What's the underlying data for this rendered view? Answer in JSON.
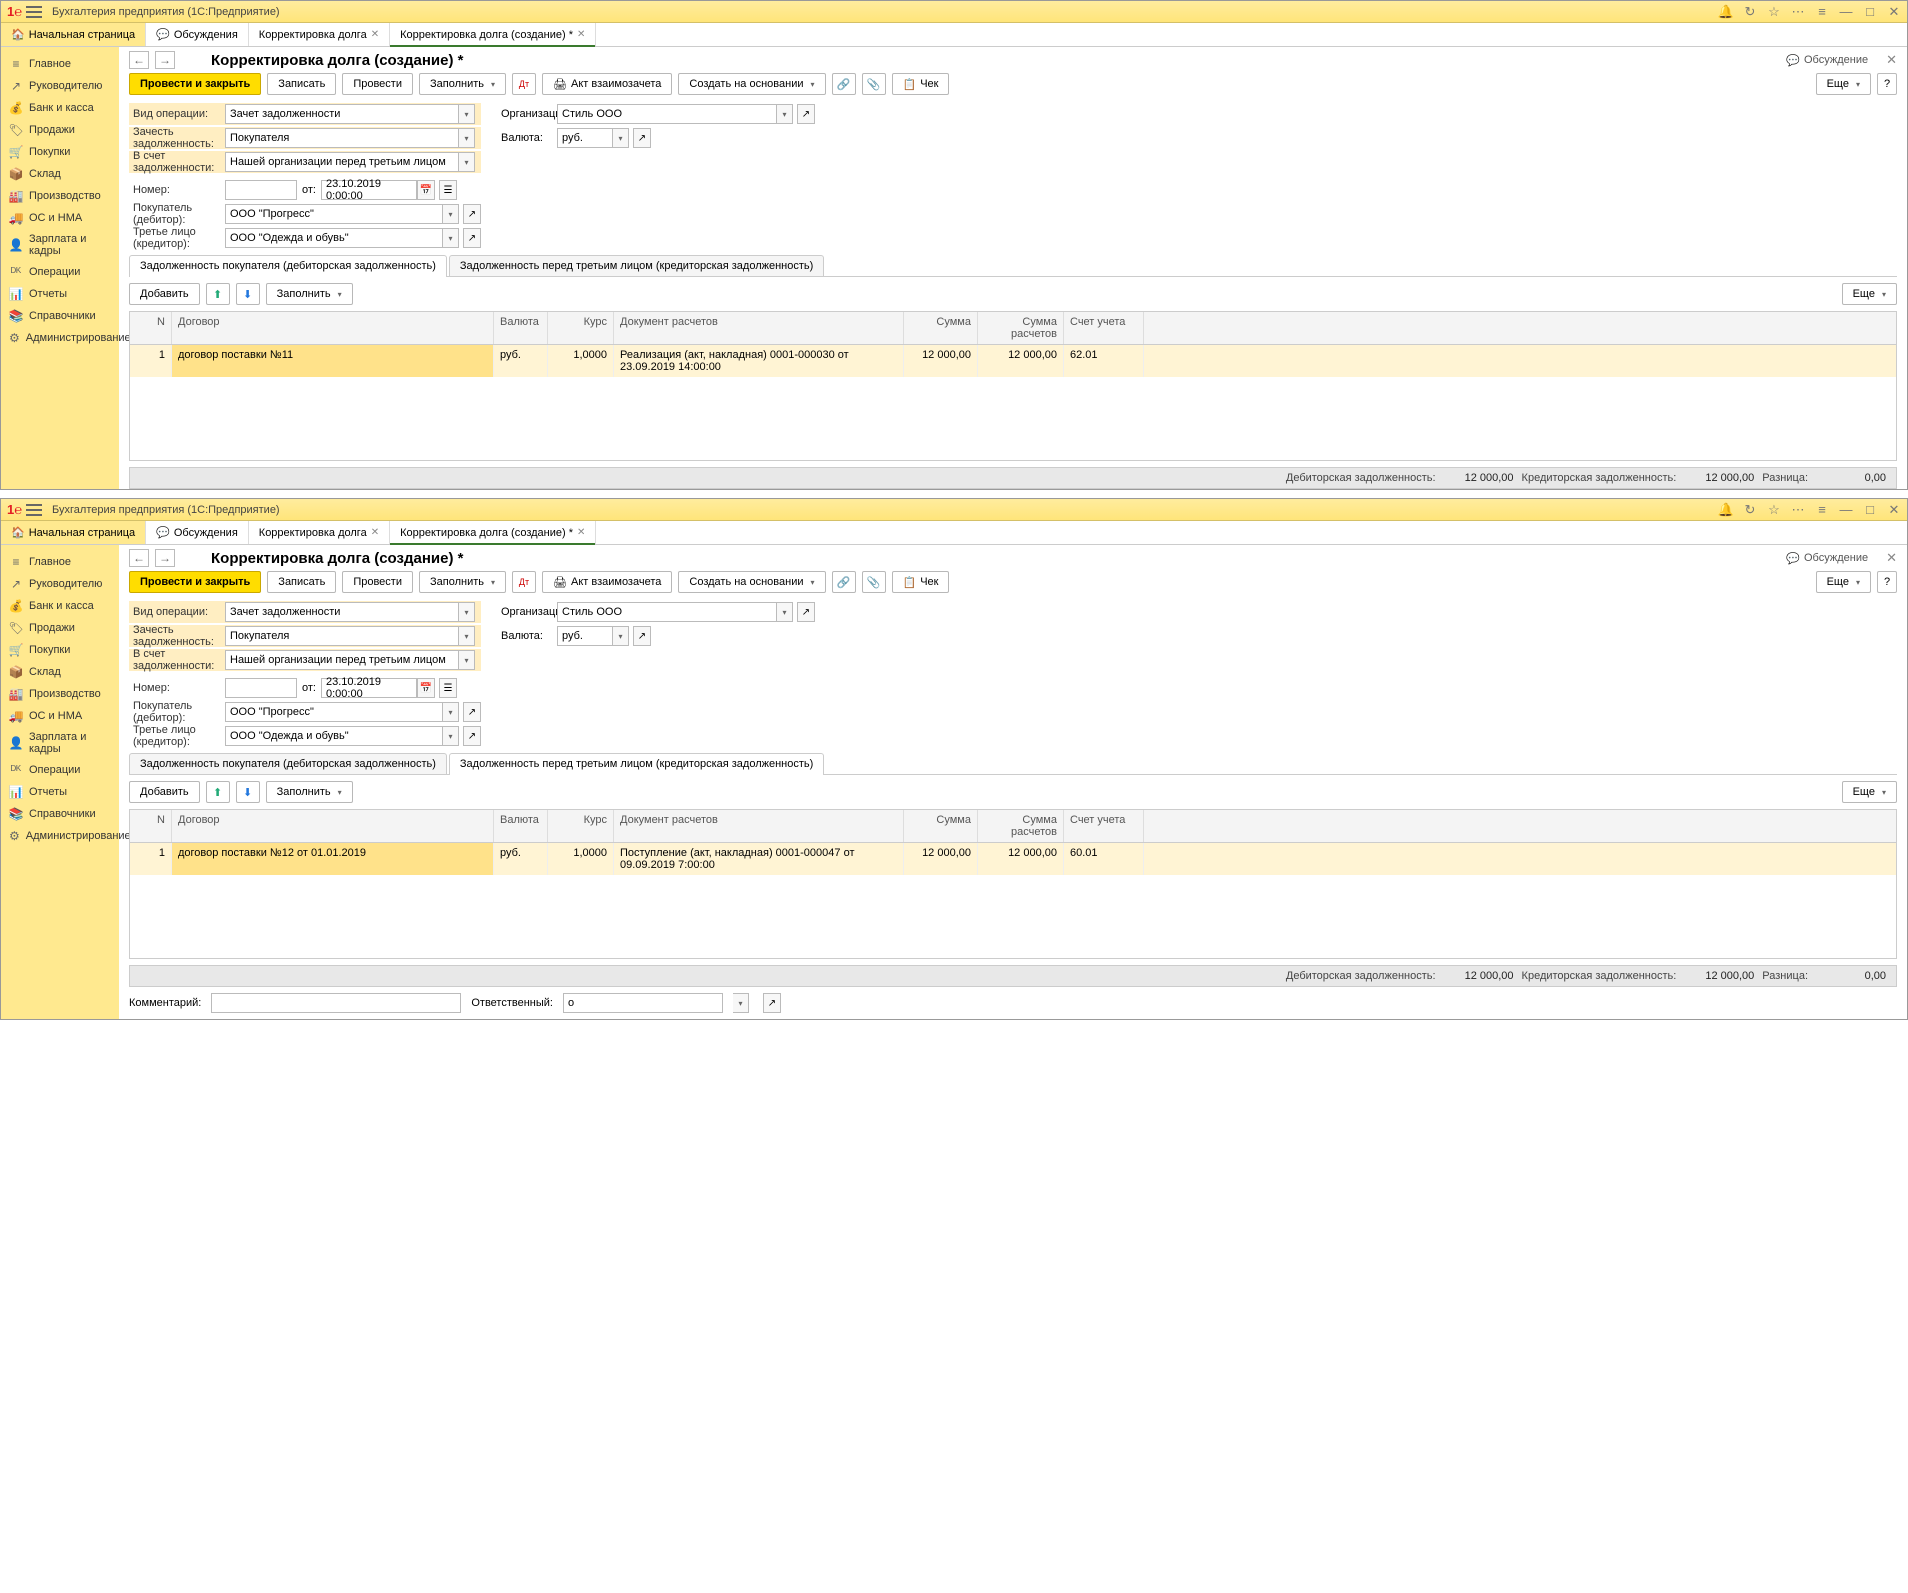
{
  "common": {
    "app_title": "Бухгалтерия предприятия  (1С:Предприятие)",
    "home_tab": "Начальная страница",
    "tabs": [
      "Обсуждения",
      "Корректировка долга",
      "Корректировка долга (создание) *"
    ],
    "sidebar": [
      "Главное",
      "Руководителю",
      "Банк и касса",
      "Продажи",
      "Покупки",
      "Склад",
      "Производство",
      "ОС и НМА",
      "Зарплата и кадры",
      "Операции",
      "Отчеты",
      "Справочники",
      "Администрирование"
    ],
    "sidebar_icons": [
      "≡",
      "↗",
      "💰",
      "🏷",
      "🛒",
      "📦",
      "🏭",
      "🚚",
      "👤",
      "ᴰᴷ",
      "📊",
      "📚",
      "⚙"
    ],
    "page_title": "Корректировка долга (создание) *",
    "discuss": "Обсуждение",
    "btns": {
      "post_close": "Провести и закрыть",
      "save": "Записать",
      "post": "Провести",
      "fill": "Заполнить",
      "act": "Акт взаимозачета",
      "create_on": "Создать на основании",
      "check": "Чек",
      "more": "Еще",
      "add": "Добавить"
    },
    "labels": {
      "op_type": "Вид операции:",
      "offset_debt": "Зачесть задолженность:",
      "against": "В счет задолженности:",
      "number": "Номер:",
      "from": "от:",
      "buyer": "Покупатель (дебитор):",
      "third": "Третье лицо (кредитор):",
      "org": "Организация:",
      "currency": "Валюта:",
      "comment": "Комментарий:",
      "resp": "Ответственный:"
    },
    "values": {
      "op_type": "Зачет задолженности",
      "offset_debt": "Покупателя",
      "against": "Нашей организации перед третьим лицом",
      "date": "23.10.2019  0:00:00",
      "buyer": "ООО \"Прогресс\"",
      "third": "ООО \"Одежда и обувь\"",
      "org": "Стиль ООО",
      "currency": "руб.",
      "resp": "о"
    },
    "subtabs": [
      "Задолженность покупателя (дебиторская задолженность)",
      "Задолженность перед третьим лицом (кредиторская задолженность)"
    ],
    "grid_head": [
      "N",
      "Договор",
      "Валюта",
      "Курс",
      "Документ расчетов",
      "Сумма",
      "Сумма расчетов",
      "Счет учета"
    ],
    "footer": {
      "deb": "Дебиторская задолженность:",
      "cred": "Кредиторская задолженность:",
      "diff": "Разница:",
      "v1": "12 000,00",
      "v2": "12 000,00",
      "v3": "0,00"
    }
  },
  "i1": {
    "active_subtab": 0,
    "row": {
      "n": "1",
      "dog": "договор поставки №11",
      "val": "руб.",
      "kurs": "1,0000",
      "doc": "Реализация (акт, накладная) 0001-000030 от 23.09.2019 14:00:00",
      "sum": "12 000,00",
      "sumr": "12 000,00",
      "acc": "62.01"
    }
  },
  "i2": {
    "active_subtab": 1,
    "row": {
      "n": "1",
      "dog": "договор поставки №12 от 01.01.2019",
      "val": "руб.",
      "kurs": "1,0000",
      "doc": "Поступление (акт, накладная) 0001-000047 от 09.09.2019 7:00:00",
      "sum": "12 000,00",
      "sumr": "12 000,00",
      "acc": "60.01"
    }
  }
}
